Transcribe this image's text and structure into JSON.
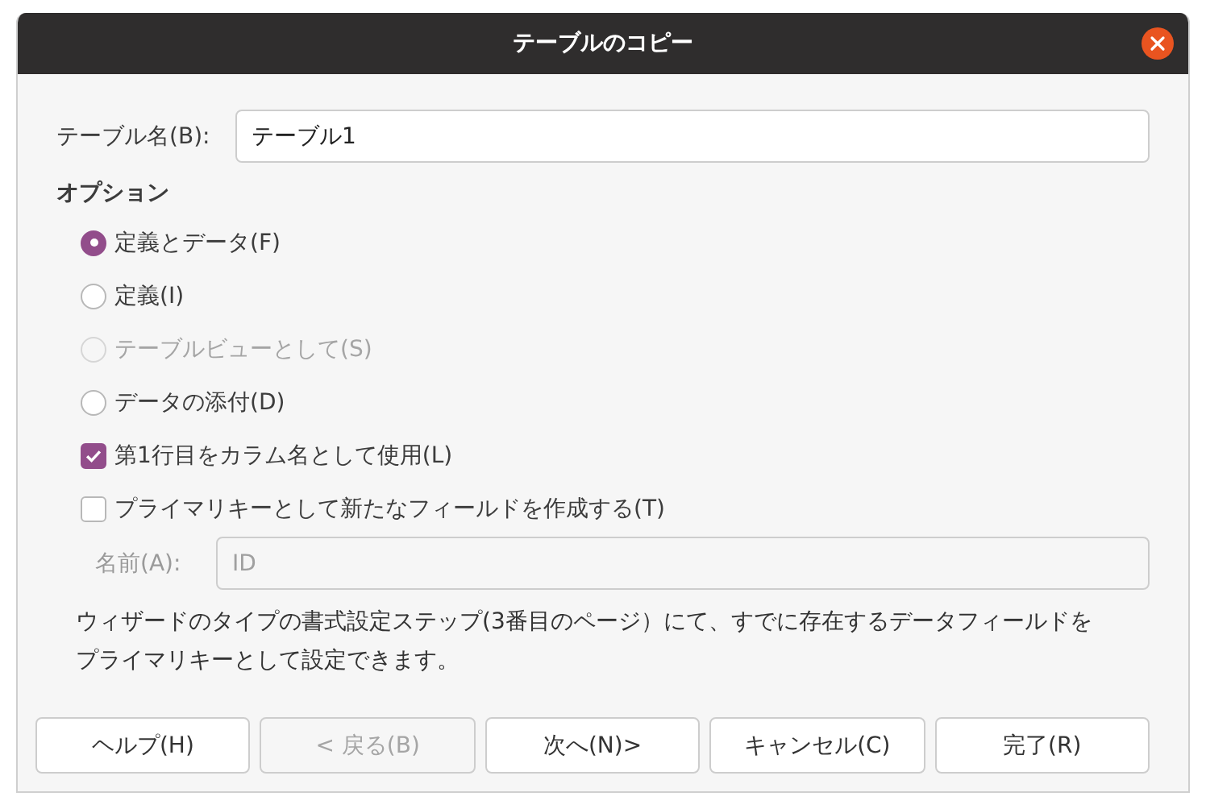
{
  "window": {
    "title": "テーブルのコピー"
  },
  "table_name": {
    "label": "テーブル名(B):",
    "value": "テーブル1"
  },
  "options": {
    "heading": "オプション",
    "items": [
      {
        "kind": "radio",
        "label": "定義とデータ(F)",
        "selected": true,
        "disabled": false
      },
      {
        "kind": "radio",
        "label": "定義(I)",
        "selected": false,
        "disabled": false
      },
      {
        "kind": "radio",
        "label": "テーブルビューとして(S)",
        "selected": false,
        "disabled": true
      },
      {
        "kind": "radio",
        "label": "データの添付(D)",
        "selected": false,
        "disabled": false
      },
      {
        "kind": "checkbox",
        "label": "第1行目をカラム名として使用(L)",
        "checked": true,
        "disabled": false
      },
      {
        "kind": "checkbox",
        "label": "プライマリキーとして新たなフィールドを作成する(T)",
        "checked": false,
        "disabled": false
      }
    ]
  },
  "key_name": {
    "label": "名前(A):",
    "value": "ID",
    "disabled": true
  },
  "note": "ウィザードのタイプの書式設定ステップ(3番目のページ）にて、すでに存在するデータフィールドをプライマリキーとして設定できます。",
  "buttons": [
    {
      "label": "ヘルプ(H)",
      "disabled": false
    },
    {
      "label": "< 戻る(B)",
      "disabled": true
    },
    {
      "label": "次へ(N)>",
      "disabled": false
    },
    {
      "label": "キャンセル(C)",
      "disabled": false
    },
    {
      "label": "完了(R)",
      "disabled": false
    }
  ]
}
